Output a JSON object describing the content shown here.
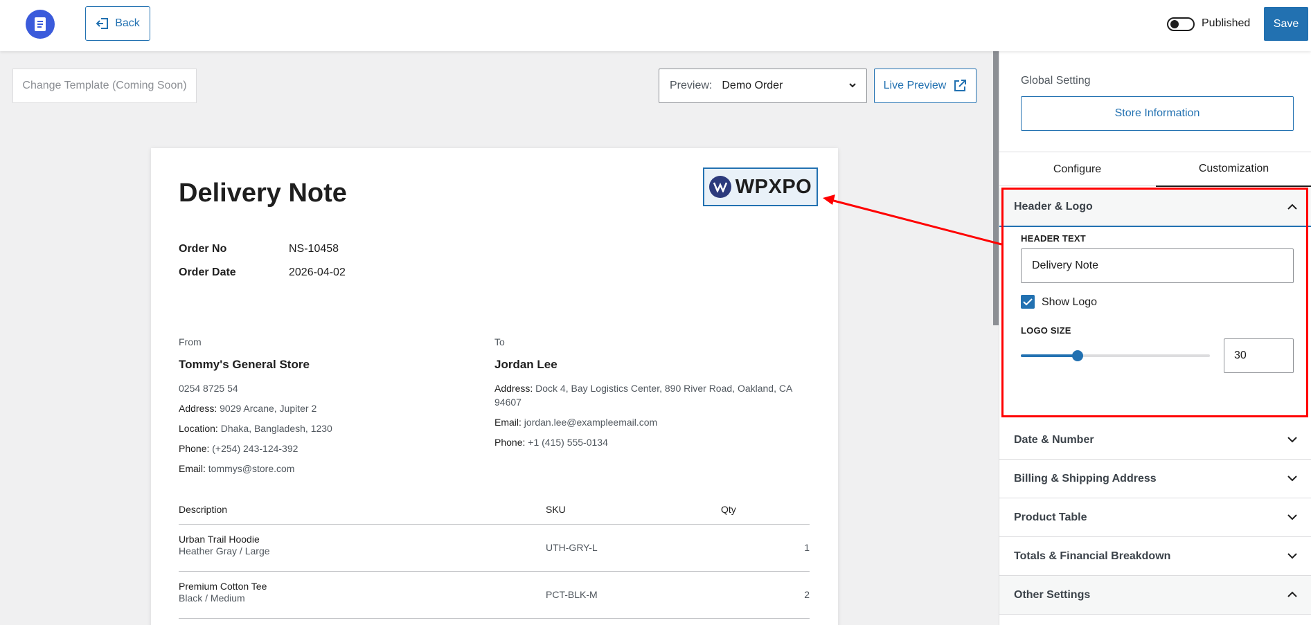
{
  "topbar": {
    "back_label": "Back",
    "published_label": "Published",
    "published_on": false,
    "save_label": "Save"
  },
  "toolbar": {
    "change_template_label": "Change Template (Coming Soon)",
    "preview_label": "Preview:",
    "preview_value": "Demo Order",
    "live_preview_label": "Live Preview"
  },
  "document": {
    "title": "Delivery Note",
    "logo_text": "WPXPO",
    "order_no_label": "Order No",
    "order_no": "NS-10458",
    "order_date_label": "Order Date",
    "order_date": "2026-04-02",
    "from": {
      "label": "From",
      "name": "Tommy's General Store",
      "phone_line": "0254 8725 54",
      "address_key": "Address:",
      "address": "9029 Arcane, Jupiter 2",
      "location_key": "Location:",
      "location": "Dhaka, Bangladesh, 1230",
      "phone_key": "Phone:",
      "phone": "(+254) 243-124-392",
      "email_key": "Email:",
      "email": "tommys@store.com"
    },
    "to": {
      "label": "To",
      "name": "Jordan Lee",
      "address_key": "Address:",
      "address": "Dock 4, Bay Logistics Center, 890 River Road, Oakland, CA 94607",
      "email_key": "Email:",
      "email": "jordan.lee@exampleemail.com",
      "phone_key": "Phone:",
      "phone": "+1 (415) 555-0134"
    },
    "table": {
      "headers": [
        "Description",
        "SKU",
        "Qty"
      ],
      "rows": [
        {
          "name": "Urban Trail Hoodie",
          "variant": "Heather Gray / Large",
          "sku": "UTH-GRY-L",
          "qty": "1"
        },
        {
          "name": "Premium Cotton Tee",
          "variant": "Black / Medium",
          "sku": "PCT-BLK-M",
          "qty": "2"
        }
      ]
    }
  },
  "sidebar": {
    "global_setting_label": "Global Setting",
    "store_info_label": "Store Information",
    "tabs": [
      "Configure",
      "Customization"
    ],
    "active_tab": "Customization",
    "sections": [
      {
        "label": "Header & Logo",
        "open": true
      },
      {
        "label": "Date & Number",
        "open": false
      },
      {
        "label": "Billing & Shipping Address",
        "open": false
      },
      {
        "label": "Product Table",
        "open": false
      },
      {
        "label": "Totals & Financial Breakdown",
        "open": false
      },
      {
        "label": "Other Settings",
        "open": true
      }
    ],
    "header_logo": {
      "header_text_label": "HEADER TEXT",
      "header_text_value": "Delivery Note",
      "show_logo_label": "Show Logo",
      "show_logo_checked": true,
      "logo_size_label": "LOGO SIZE",
      "logo_size_value": "30",
      "logo_size_fraction": 0.3
    }
  },
  "colors": {
    "accent": "#2271b1",
    "annotation": "#ff0000",
    "app_logo": "#3b5bdb"
  }
}
